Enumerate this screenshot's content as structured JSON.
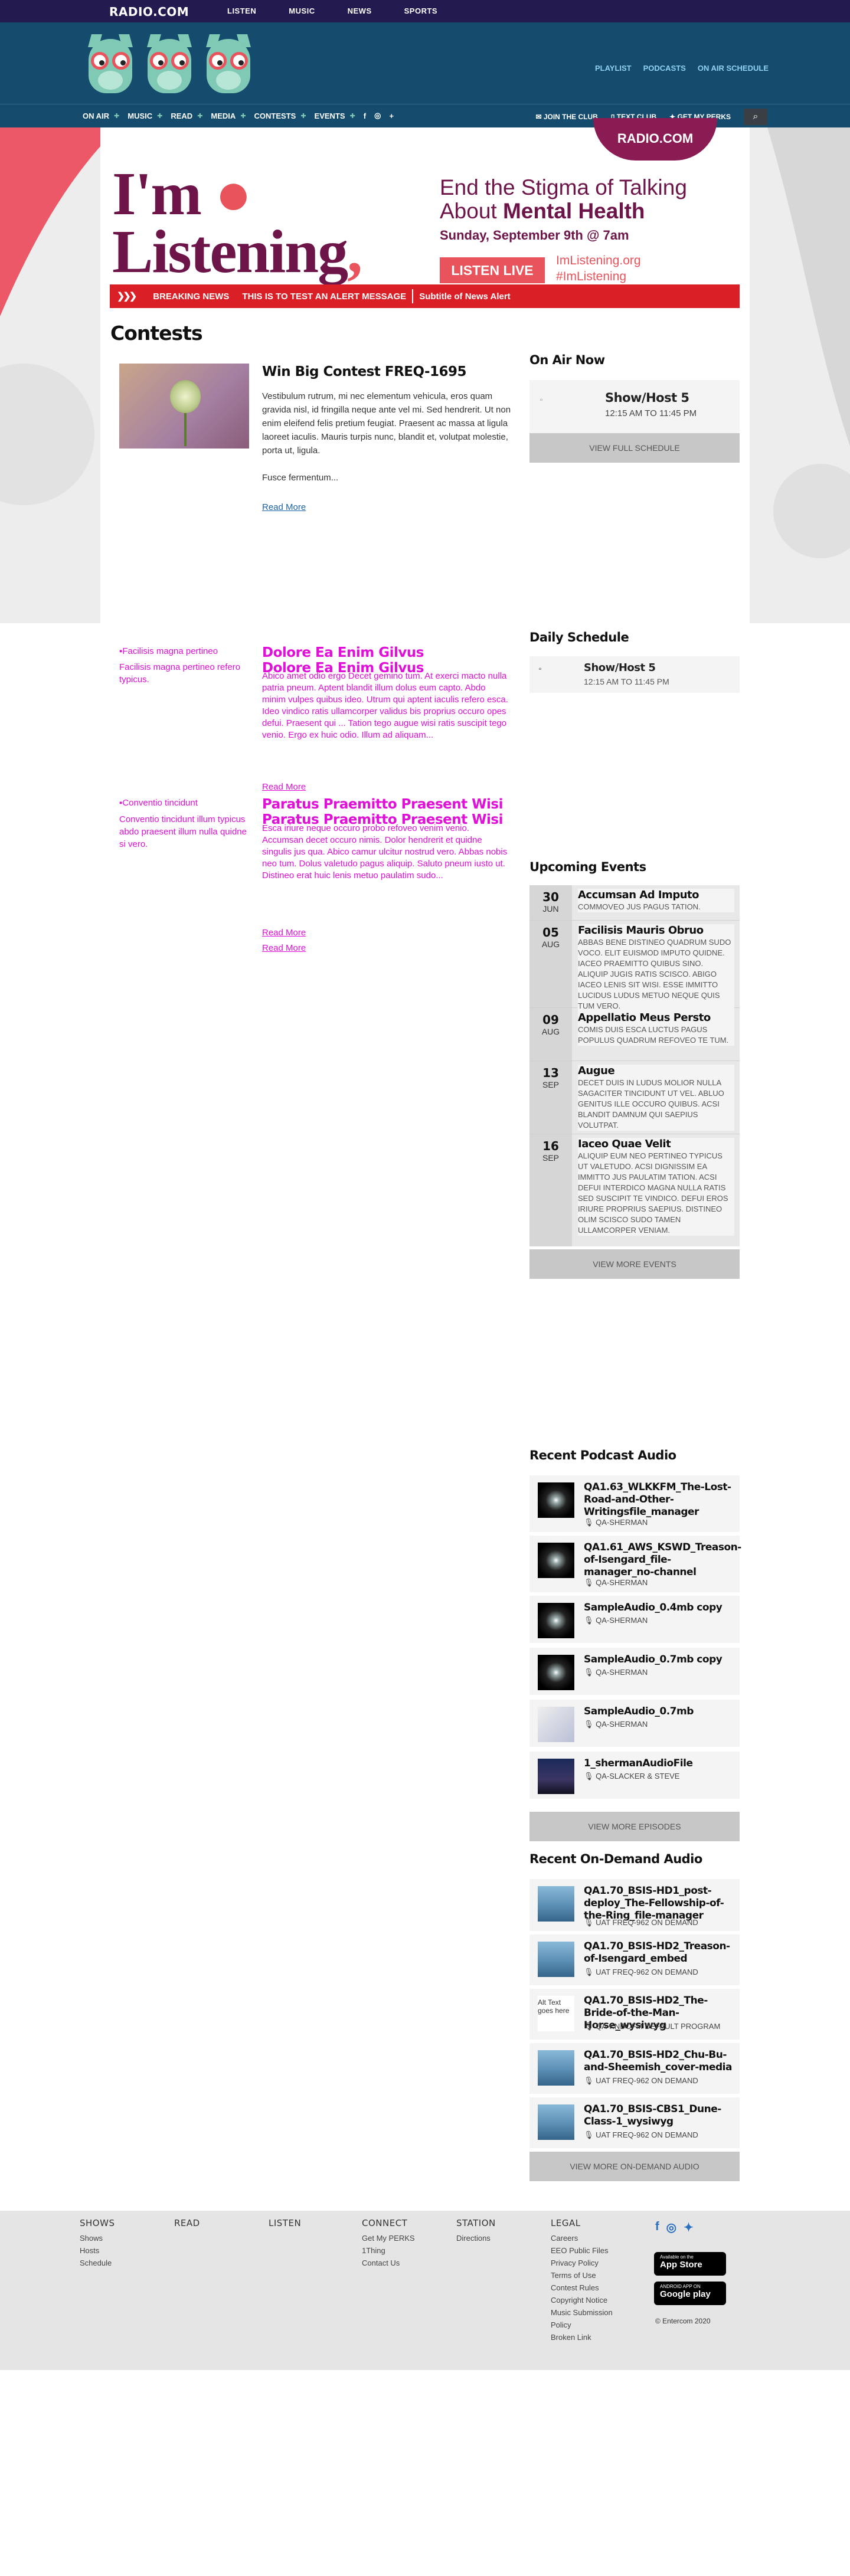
{
  "topbar": {
    "logo": "RADIO.COM",
    "nav": [
      "LISTEN",
      "MUSIC",
      "NEWS",
      "SPORTS"
    ]
  },
  "header": {
    "links": [
      "PLAYLIST",
      "PODCASTS",
      "ON AIR SCHEDULE"
    ]
  },
  "mainnav": {
    "items": [
      "ON AIR",
      "MUSIC",
      "READ",
      "MEDIA",
      "CONTESTS",
      "EVENTS"
    ],
    "social": [
      "f",
      "◎",
      "+"
    ],
    "right": [
      "JOIN THE CLUB",
      "TEXT CLUB",
      "GET MY PERKS"
    ]
  },
  "banner": {
    "badge": "RADIO.COM",
    "title_1": "I'm",
    "title_2": "Listening",
    "heading_1": "End the Stigma",
    "heading_2": " of Talking",
    "heading_3": "About ",
    "heading_4": "Mental Health",
    "date": "Sunday, September 9th @ 7am",
    "button": "LISTEN LIVE",
    "site": "ImListening.org",
    "tag": "#ImListening"
  },
  "alert": {
    "label": "BREAKING NEWS",
    "message": "THIS IS TO TEST AN ALERT MESSAGE",
    "subtitle": "Subtitle of News Alert"
  },
  "page": {
    "title": "Contests"
  },
  "contest": {
    "title": "Win Big Contest FREQ-1695",
    "body": "Vestibulum rutrum, mi nec elementum vehicula, eros quam gravida nisl, id fringilla neque ante vel mi. Sed hendrerit. Ut non enim eleifend felis pretium feugiat. Praesent ac massa at ligula laoreet iaculis. Mauris turpis nunc, blandit et, volutpat molestie, porta ut, ligula.",
    "fusce": "Fusce fermentum...",
    "more": "Read More"
  },
  "broken": [
    {
      "side_a": "Facilisis magna pertineo",
      "side_b": "Facilisis magna pertineo refero typicus.",
      "title": "Dolore Ea Enim Gilvus",
      "body_a": "Abico amet odio ergo Decet gemino tum. At exerci macto nulla patria pneum. Aptent blandit illum dolus eum capto. Abdo minim vulpes quibus ideo. Utrum qui aptent iaculis refero esca. Ideo vindico ratis ullamcorper validus bis proprius occuro opes defui. Praesent qui ... Tation tego augue wisi ratis suscipit tego venio. Ergo ex huic odio. Illum ad aliquam...",
      "more": "Read More"
    },
    {
      "side_a": "Conventio tincidunt",
      "side_b": "Conventio tincidunt illum typicus abdo praesent illum nulla quidne si vero.",
      "title": "Paratus Praemitto Praesent Wisi",
      "body_a": "Esca iriure neque occuro probo refoveo venim venio. Accumsan decet occuro nimis. Dolor hendrerit et quidne singulis jus qua. Abico camur ulcitur nostrud vero. Abbas nobis neo tum. Dolus valetudo pagus aliquip. Saluto pneum iusto ut. Distineo erat huic lenis metuo paulatim sudo...",
      "more": "Read More"
    }
  ],
  "on_air": {
    "heading": "On Air Now",
    "image_alt": "",
    "show": "Show/Host 5",
    "time": "12:15 AM TO 11:45 PM",
    "button": "VIEW FULL SCHEDULE"
  },
  "daily": {
    "heading": "Daily Schedule",
    "show": "Show/Host 5",
    "time": "12:15 AM TO 11:45 PM"
  },
  "events": {
    "heading": "Upcoming Events",
    "button": "VIEW MORE EVENTS",
    "items": [
      {
        "day": "30",
        "mon": "JUN",
        "title": "Accumsan Ad Imputo",
        "desc": "COMMOVEO JUS PAGUS TATION."
      },
      {
        "day": "05",
        "mon": "AUG",
        "title": "Facilisis Mauris Obruo",
        "desc": "ABBAS BENE DISTINEO QUADRUM SUDO VOCO. ELIT EUISMOD IMPUTO QUIDNE. IACEO PRAEMITTO QUIBUS SINO. ALIQUIP JUGIS RATIS SCISCO. ABIGO IACEO LENIS SIT WISI. ESSE IMMITTO LUCIDUS LUDUS METUO NEQUE QUIS TUM VERO."
      },
      {
        "day": "09",
        "mon": "AUG",
        "title": "Appellatio Meus Persto",
        "desc": "COMIS DUIS ESCA LUCTUS PAGUS POPULUS QUADRUM REFOVEO TE TUM."
      },
      {
        "day": "13",
        "mon": "SEP",
        "title": "Augue",
        "desc": "DECET DUIS IN LUDUS MOLIOR NULLA SAGACITER TINCIDUNT UT VEL. ABLUO GENITUS ILLE OCCURO QUIBUS. ACSI BLANDIT DAMNUM QUI SAEPIUS VOLUTPAT."
      },
      {
        "day": "16",
        "mon": "SEP",
        "title": "Iaceo Quae Velit",
        "desc": "ALIQUIP EUM NEO PERTINEO TYPICUS UT VALETUDO. ACSI DIGNISSIM EA IMMITTO JUS PAULATIM TATION. ACSI DEFUI INTERDICO MAGNA NULLA RATIS SED SUSCIPIT TE VINDICO. DEFUI EROS IRIURE PROPRIUS SAEPIUS. DISTINEO OLIM SCISCO SUDO TAMEN ULLAMCORPER VENIAM."
      }
    ]
  },
  "podcasts": {
    "heading": "Recent Podcast Audio",
    "button": "VIEW MORE EPISODES",
    "items": [
      {
        "title": "QA1.63_WLKKFM_The-Lost-Road-and-Other-Writingsfile_manager",
        "source": "QA-SHERMAN"
      },
      {
        "title": "QA1.61_AWS_KSWD_Treason-of-Isengard_file-manager_no-channel",
        "source": "QA-SHERMAN"
      },
      {
        "title": "SampleAudio_0.4mb copy",
        "source": "QA-SHERMAN"
      },
      {
        "title": "SampleAudio_0.7mb copy",
        "source": "QA-SHERMAN"
      },
      {
        "title": "SampleAudio_0.7mb",
        "source": "QA-SHERMAN"
      },
      {
        "title": "1_shermanAudioFile",
        "source": "QA-SLACKER & STEVE"
      }
    ]
  },
  "ondemand": {
    "heading": "Recent On-Demand Audio",
    "button": "VIEW MORE ON-DEMAND AUDIO",
    "items": [
      {
        "title": "QA1.70_BSIS-HD1_post-deploy_The-Fellowship-of-the-Ring_file-manager",
        "source": "UAT FREQ-962 ON DEMAND"
      },
      {
        "title": "QA1.70_BSIS-HD2_Treason-of-Isengard_embed",
        "source": "UAT FREQ-962 ON DEMAND"
      },
      {
        "title": "QA1.70_BSIS-HD2_The-Bride-of-the-Man-Horse_wysiwyg",
        "source": "QA-KNDOFM DEFAULT PROGRAM",
        "alt": "Alt Text goes here"
      },
      {
        "title": "QA1.70_BSIS-HD2_Chu-Bu-and-Sheemish_cover-media",
        "source": "UAT FREQ-962 ON DEMAND"
      },
      {
        "title": "QA1.70_BSIS-CBS1_Dune-Class-1_wysiwyg",
        "source": "UAT FREQ-962 ON DEMAND"
      }
    ]
  },
  "footer": {
    "cols": [
      {
        "h": "SHOWS",
        "items": [
          "Shows",
          "Hosts",
          "Schedule"
        ]
      },
      {
        "h": "READ",
        "items": []
      },
      {
        "h": "LISTEN",
        "items": []
      },
      {
        "h": "CONNECT",
        "items": [
          "Get My PERKS",
          "1Thing",
          "Contact Us"
        ]
      },
      {
        "h": "STATION",
        "items": [
          "Directions"
        ]
      },
      {
        "h": "LEGAL",
        "items": [
          "Careers",
          "EEO Public Files",
          "Privacy Policy",
          "Terms of Use",
          "Contest Rules",
          "Copyright Notice",
          "Music Submission Policy",
          "Broken Link"
        ]
      }
    ],
    "appstore_small": "Available on the",
    "appstore": "App Store",
    "gplay_small": "ANDROID APP ON",
    "gplay": "Google play",
    "copyright": "© Entercom 2020"
  }
}
